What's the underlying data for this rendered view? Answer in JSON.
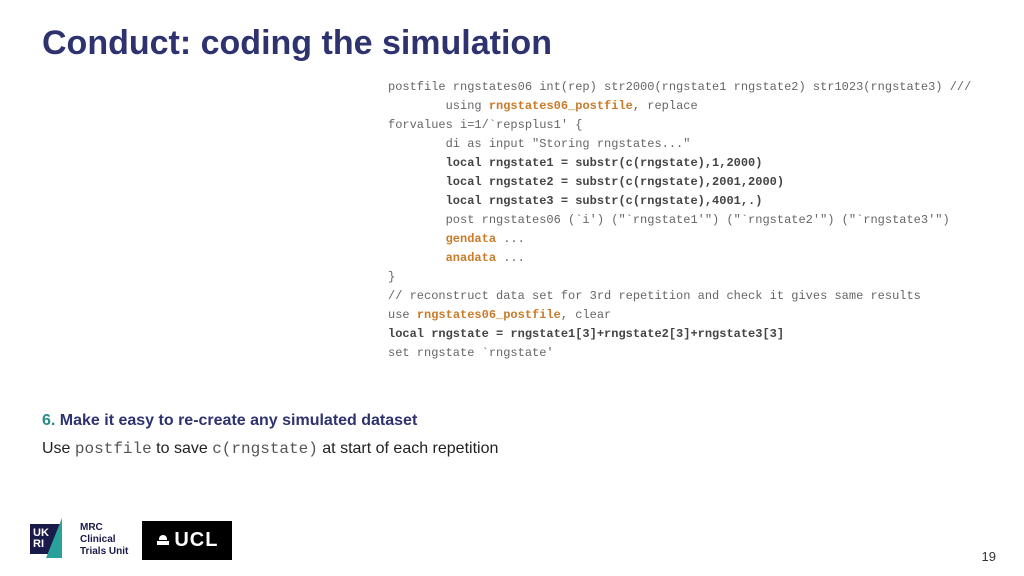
{
  "title": "Conduct: coding the simulation",
  "code": {
    "l1a": "postfile rngstates06 int(rep) str2000(rngstate1 rngstate2) str1023(rngstate3) ///",
    "l2a": "        using ",
    "l2b": "rngstates06_postfile",
    "l2c": ", replace",
    "l3": "forvalues i=1/`repsplus1' {",
    "l4": "        di as input \"Storing rngstates...\"",
    "l5": "        local rngstate1 = substr(c(rngstate),1,2000)",
    "l6": "        local rngstate2 = substr(c(rngstate),2001,2000)",
    "l7": "        local rngstate3 = substr(c(rngstate),4001,.)",
    "l8": "        post rngstates06 (`i') (\"`rngstate1'\") (\"`rngstate2'\") (\"`rngstate3'\")",
    "l9a": "        ",
    "l9b": "gendata",
    "l9c": " ...",
    "l10a": "        ",
    "l10b": "anadata",
    "l10c": " ...",
    "l11": "}",
    "l12": "// reconstruct data set for 3rd repetition and check it gives same results",
    "l13a": "use ",
    "l13b": "rngstates06_postfile",
    "l13c": ", clear",
    "l14": "local rngstate = rngstate1[3]+rngstate2[3]+rngstate3[3]",
    "l15": "set rngstate `rngstate'"
  },
  "point": {
    "num": "6.",
    "text": " Make it easy to re-create any simulated dataset"
  },
  "desc": {
    "pre": "Use ",
    "code1": "postfile",
    "mid": " to save ",
    "code2": "c(rngstate)",
    "post": " at start of each repetition"
  },
  "footer": {
    "ukri_line1": "UK",
    "ukri_line2": "RI",
    "mrc_line1": "MRC",
    "mrc_line2": "Clinical",
    "mrc_line3": "Trials Unit",
    "ucl": "UCL"
  },
  "pagenum": "19"
}
